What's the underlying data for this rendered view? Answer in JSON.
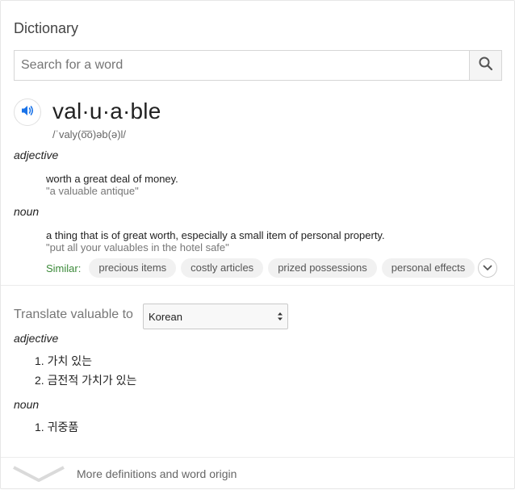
{
  "header": {
    "title": "Dictionary"
  },
  "search": {
    "placeholder": "Search for a word",
    "value": "",
    "icon": "search-icon"
  },
  "entry": {
    "word": "val·u·a·ble",
    "phonetic": "/ˈvaly(o͞o)əb(ə)l/",
    "audio_icon": "speaker-icon",
    "senses": [
      {
        "pos": "adjective",
        "definition": "worth a great deal of money.",
        "example": "\"a valuable antique\""
      },
      {
        "pos": "noun",
        "definition": "a thing that is of great worth, especially a small item of personal property.",
        "example": "\"put all your valuables in the hotel safe\""
      }
    ],
    "similar": {
      "label": "Similar:",
      "items": [
        "precious items",
        "costly articles",
        "prized possessions",
        "personal effects"
      ]
    }
  },
  "translate": {
    "label": "Translate valuable to",
    "selected_language": "Korean",
    "groups": [
      {
        "pos": "adjective",
        "items": [
          "1. 가치 있는",
          "2. 금전적 가치가 있는"
        ]
      },
      {
        "pos": "noun",
        "items": [
          "1. 귀중품"
        ]
      }
    ]
  },
  "footer": {
    "more_label": "More definitions and word origin"
  },
  "colors": {
    "accent_blue": "#1a73e8",
    "similar_green": "#3c8a3a"
  }
}
